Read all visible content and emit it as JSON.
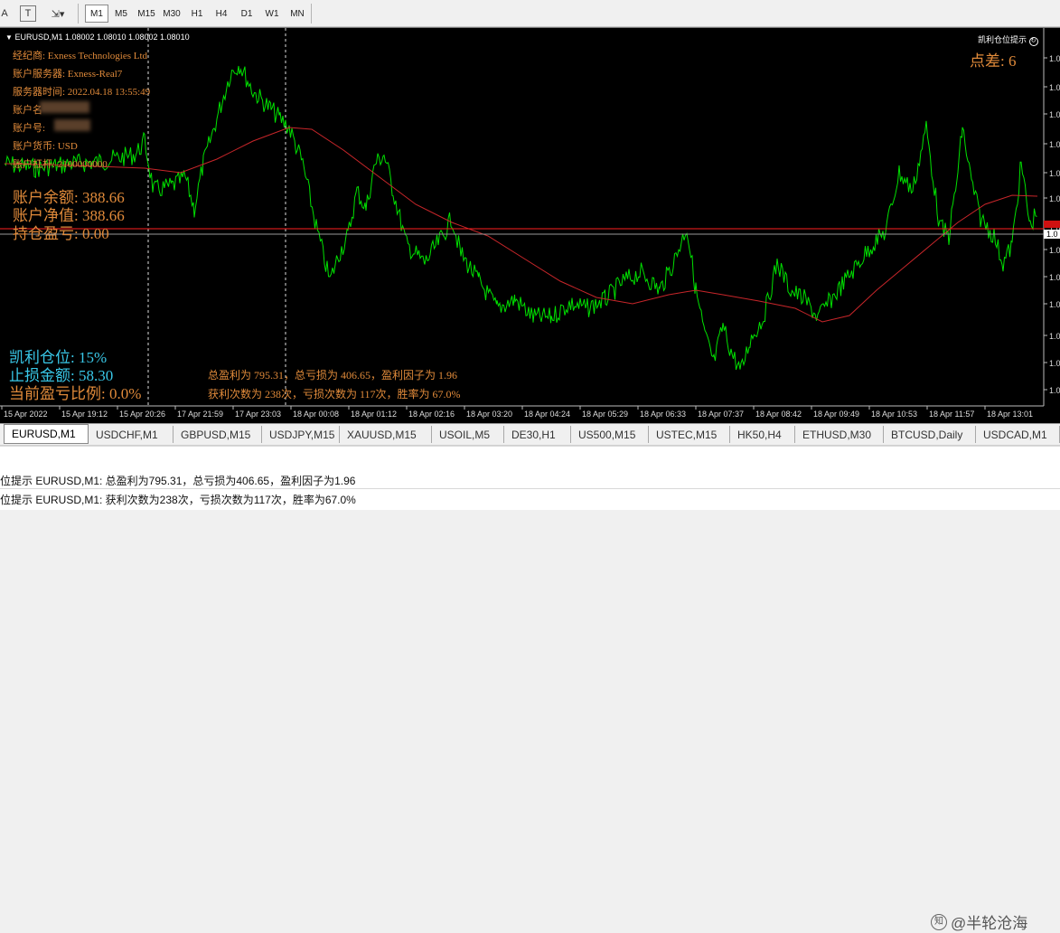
{
  "toolbar": {
    "a_label": "A",
    "t_label": "T",
    "timeframes": [
      "M1",
      "M5",
      "M15",
      "M30",
      "H1",
      "H4",
      "D1",
      "W1",
      "MN"
    ],
    "active_timeframe": "M1"
  },
  "chart": {
    "header": "EURUSD,M1  1.08002 1.08010 1.08002 1.08010",
    "indicator_name": "凯利仓位提示",
    "spread": "点差: 6",
    "info_lines": [
      "经纪商: Exness Technologies Ltd",
      "账户服务器: Exness-Real7",
      "服务器时间: 2022.04.18 13:55:49",
      "账户名",
      "账户号:",
      "账户货币: USD",
      "账户杠杆: 2100000000"
    ],
    "balance": "账户余额: 388.66",
    "equity": "账户净值: 388.66",
    "position_pnl": "持仓盈亏: 0.00",
    "kelly_position": "凯利仓位: 15%",
    "stop_loss_amount": "止损金额: 58.30",
    "current_pnl_ratio": "当前盈亏比例: 0.0%",
    "stats_line1": "总盈利为 795.31，总亏损为 406.65，盈利因子为 1.96",
    "stats_line2": "获利次数为 238次，亏损次数为 117次，胜率为 67.0%",
    "price_labels": [
      "1.0",
      "1.0",
      "1.0",
      "1.0",
      "1.0",
      "1.0",
      "1.0",
      "1.0",
      "1.0",
      "1.0",
      "1.0",
      "1.0",
      "1.0",
      "1.0",
      "1.0"
    ],
    "current_price_label": "1.0",
    "time_labels": [
      "15 Apr 2022",
      "15 Apr 19:12",
      "15 Apr 20:26",
      "17 Apr 21:59",
      "17 Apr 23:03",
      "18 Apr 00:08",
      "18 Apr 01:12",
      "18 Apr 02:16",
      "18 Apr 03:20",
      "18 Apr 04:24",
      "18 Apr 05:29",
      "18 Apr 06:33",
      "18 Apr 07:37",
      "18 Apr 08:42",
      "18 Apr 09:49",
      "18 Apr 10:53",
      "18 Apr 11:57",
      "18 Apr 13:01"
    ],
    "colors": {
      "price": "#00e000",
      "ma": "#c8262a",
      "hline": "#ff2020",
      "text": "#e08a3a",
      "cyan": "#39c8e8"
    }
  },
  "tabs": [
    "EURUSD,M1",
    "USDCHF,M1",
    "GBPUSD,M15",
    "USDJPY,M15",
    "XAUUSD,M15",
    "USOIL,M5",
    "DE30,H1",
    "US500,M15",
    "USTEC,M15",
    "HK50,H4",
    "ETHUSD,M30",
    "BTCUSD,Daily",
    "USDCAD,M1"
  ],
  "active_tab": "EURUSD,M1",
  "alerts": [
    "位提示 EURUSD,M1: 总盈利为795.31，总亏损为406.65，盈利因子为1.96",
    "位提示 EURUSD,M1: 获利次数为238次，亏损次数为117次，胜率为67.0%"
  ],
  "watermark": "@半轮沧海"
}
